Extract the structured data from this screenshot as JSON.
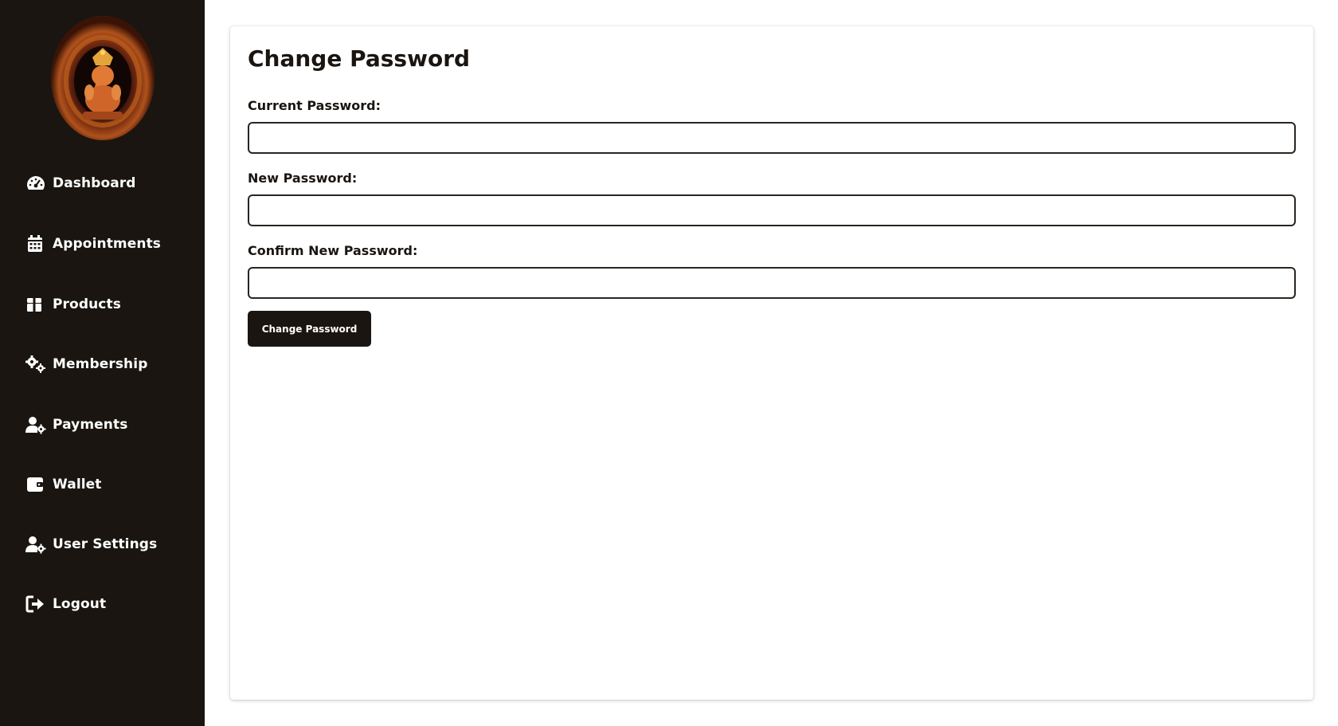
{
  "sidebar": {
    "logo_alt": "logo",
    "items": [
      {
        "label": "Dashboard",
        "icon": "dashboard-gauge-icon"
      },
      {
        "label": "Appointments",
        "icon": "calendar-icon"
      },
      {
        "label": "Products",
        "icon": "gift-box-icon"
      },
      {
        "label": "Membership",
        "icon": "gears-icon"
      },
      {
        "label": "Payments",
        "icon": "user-gear-icon"
      },
      {
        "label": "Wallet",
        "icon": "wallet-icon"
      },
      {
        "label": "User Settings",
        "icon": "user-gear-icon"
      },
      {
        "label": "Logout",
        "icon": "logout-icon"
      }
    ]
  },
  "form": {
    "title": "Change Password",
    "current_label": "Current Password:",
    "current_value": "",
    "new_label": "New Password:",
    "new_value": "",
    "confirm_label": "Confirm New Password:",
    "confirm_value": "",
    "submit_label": "Change Password"
  },
  "colors": {
    "sidebar_bg": "#1a1510",
    "button_bg": "#1a1510",
    "text_dark": "#1a1510"
  }
}
